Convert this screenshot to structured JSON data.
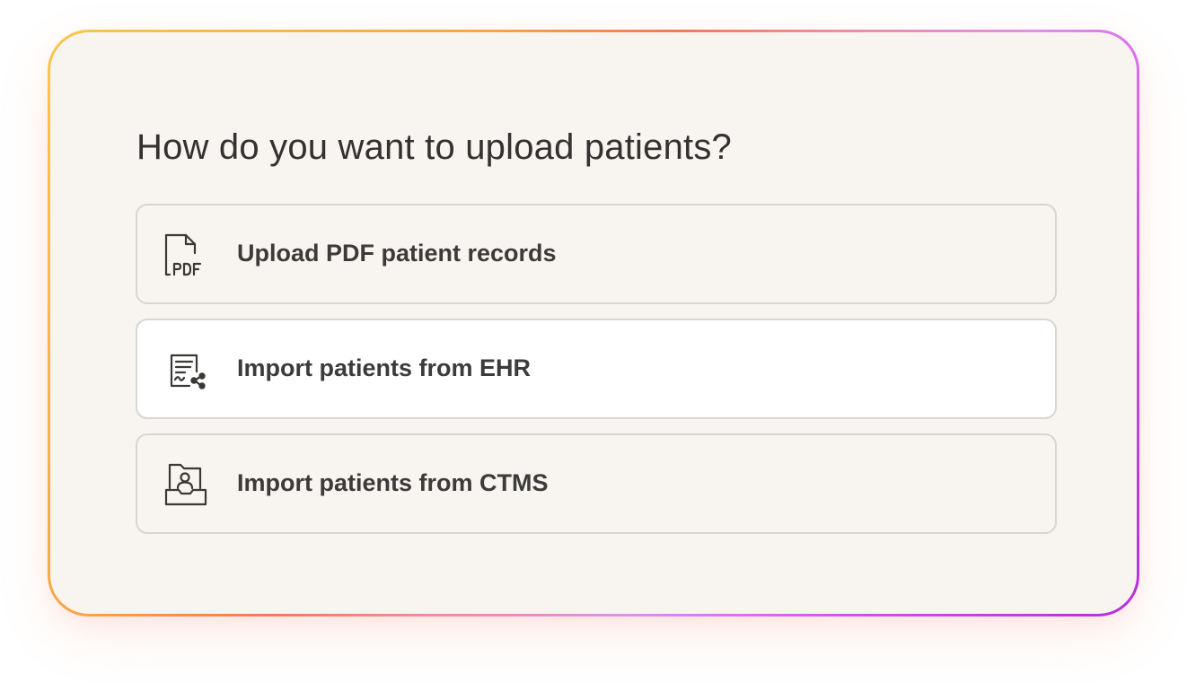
{
  "dialog": {
    "title": "How do you want to upload patients?",
    "options": [
      {
        "label": "Upload PDF patient records",
        "icon": "pdf-file-icon",
        "selected": false
      },
      {
        "label": "Import patients from EHR",
        "icon": "record-share-icon",
        "selected": true
      },
      {
        "label": "Import patients from CTMS",
        "icon": "patient-folder-icon",
        "selected": false
      }
    ]
  },
  "colors": {
    "card_background": "#f8f5f0",
    "option_border": "#d9d6d1",
    "selected_background": "#ffffff",
    "text": "#333230",
    "border_gradient": [
      "#fbc74a",
      "#f47a54",
      "#e58cf0",
      "#b52ed9"
    ]
  }
}
